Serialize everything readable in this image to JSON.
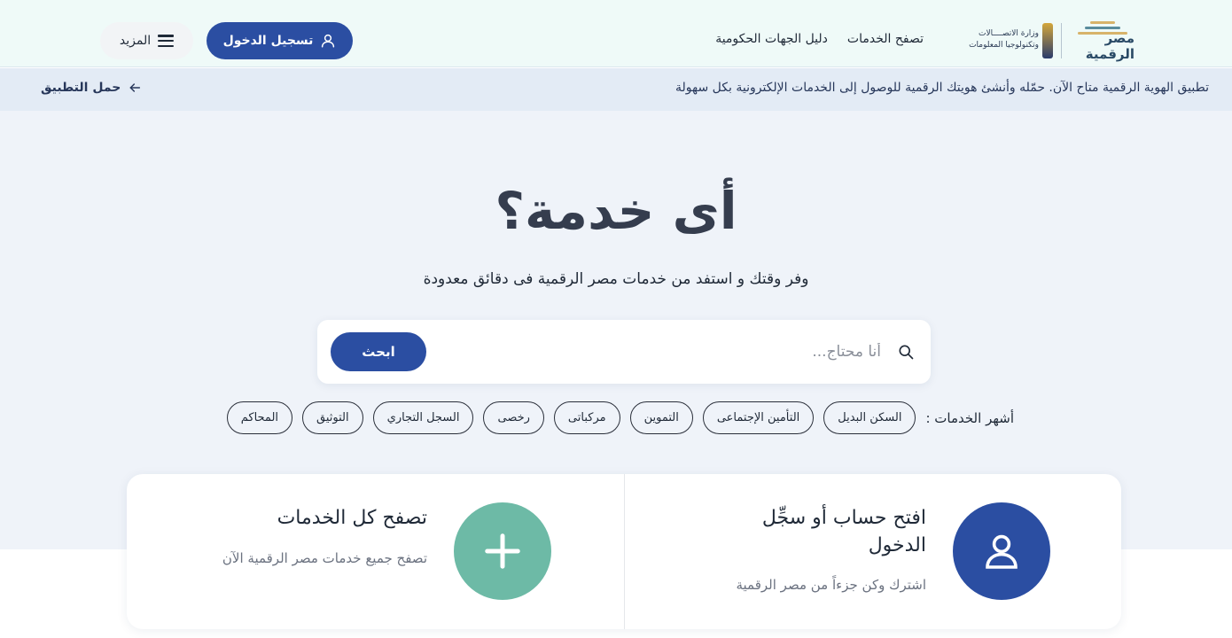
{
  "header": {
    "logo_text": "مصر الرقمية",
    "ministry_line1": "وزارة الاتصــــالات",
    "ministry_line2": "وتكنولوجيا المعلومات",
    "nav": [
      "تصفح الخدمات",
      "دليل الجهات الحكومية"
    ],
    "login_label": "تسجيل الدخول",
    "more_label": "المزيد"
  },
  "announcement": {
    "text": "تطبيق الهوية الرقمية متاح الآن. حمّله وأنشئ هويتك الرقمية للوصول إلى الخدمات الإلكترونية بكل سهولة",
    "link_label": "حمل التطبيق"
  },
  "hero": {
    "title": "أى خدمة؟",
    "subtitle": "وفر وقتك و استفد من خدمات مصر الرقمية فى دقائق معدودة"
  },
  "search": {
    "placeholder": "أنا محتاج...",
    "button_label": "ابحث"
  },
  "popular": {
    "label": "أشهر الخدمات :",
    "chips": [
      "السكن البديل",
      "التأمين الإجتماعى",
      "التموين",
      "مركباتى",
      "رخصى",
      "السجل التجاري",
      "التوثيق",
      "المحاكم"
    ]
  },
  "cards": {
    "account": {
      "title": "افتح حساب أو سجِّل الدخول",
      "description": "اشترك وكن جزءاً من مصر الرقمية"
    },
    "browse": {
      "title": "تصفح كل الخدمات",
      "description": "تصفح جميع خدمات مصر الرقمية الآن"
    }
  },
  "colors": {
    "primary": "#2b4ea2",
    "teal": "#6dbaa6",
    "header_bg": "#effaf8",
    "announce_bg": "#e3ebf5",
    "hero_bg": "#eff3f9"
  }
}
